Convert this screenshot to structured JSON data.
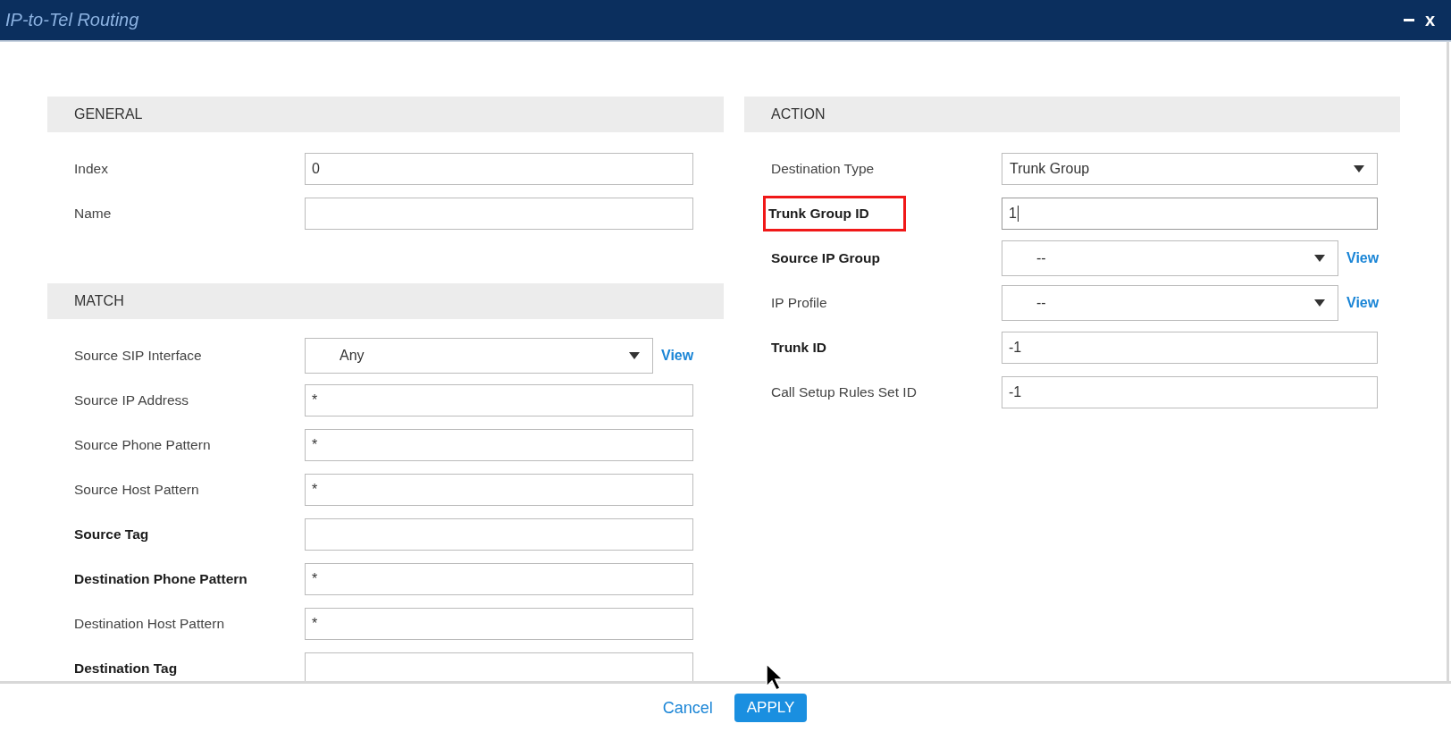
{
  "window": {
    "title": "IP-to-Tel Routing",
    "close": "x"
  },
  "columns": [
    [
      {
        "title": "GENERAL",
        "fields": [
          {
            "label": "Index",
            "kind": "text",
            "value": "0",
            "emphasized": false,
            "highlighted": false
          },
          {
            "label": "Name",
            "kind": "text",
            "emphasized": false,
            "highlighted": false
          }
        ]
      },
      {
        "title": "MATCH",
        "fields": [
          {
            "label": "Source SIP Interface",
            "kind": "select",
            "value": "Any",
            "emphasized": false,
            "highlighted": false,
            "link": "View"
          },
          {
            "label": "Source IP Address",
            "kind": "text",
            "value": "*",
            "emphasized": false,
            "highlighted": false
          },
          {
            "label": "Source Phone Pattern",
            "kind": "text",
            "value": "*",
            "emphasized": false,
            "highlighted": false
          },
          {
            "label": "Source Host Pattern",
            "kind": "text",
            "value": "*",
            "emphasized": false,
            "highlighted": false
          },
          {
            "label": "Source Tag",
            "kind": "text",
            "emphasized": true,
            "highlighted": false
          },
          {
            "label": "Destination Phone Pattern",
            "kind": "text",
            "value": "*",
            "emphasized": true,
            "highlighted": false
          },
          {
            "label": "Destination Host Pattern",
            "kind": "text",
            "value": "*",
            "emphasized": false,
            "highlighted": false
          },
          {
            "label": "Destination Tag",
            "kind": "text",
            "emphasized": true,
            "highlighted": false
          }
        ]
      }
    ],
    [
      {
        "title": "ACTION",
        "fields": [
          {
            "label": "Destination Type",
            "kind": "select",
            "value": "Trunk Group",
            "emphasized": false,
            "highlighted": false
          },
          {
            "label": "Trunk Group ID",
            "kind": "text",
            "value": "1",
            "emphasized": true,
            "highlighted": true,
            "focused": true
          },
          {
            "label": "Source IP Group",
            "kind": "select",
            "value": "--",
            "emphasized": true,
            "highlighted": false,
            "link": "View"
          },
          {
            "label": "IP Profile",
            "kind": "select",
            "value": "--",
            "emphasized": false,
            "highlighted": false,
            "link": "View"
          },
          {
            "label": "Trunk ID",
            "kind": "text",
            "value": "-1",
            "emphasized": true,
            "highlighted": false
          },
          {
            "label": "Call Setup Rules Set ID",
            "kind": "text",
            "value": "-1",
            "emphasized": false,
            "highlighted": false
          }
        ]
      }
    ]
  ],
  "footer": {
    "cancel": "Cancel",
    "apply": "APPLY"
  }
}
